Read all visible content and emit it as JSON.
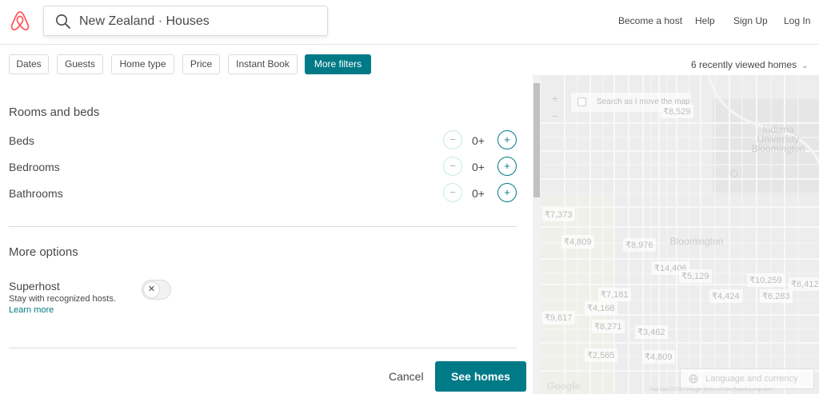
{
  "header": {
    "search_text": "New Zealand · Houses",
    "nav": {
      "become_host": "Become a host",
      "help": "Help",
      "sign_up": "Sign Up",
      "log_in": "Log In"
    }
  },
  "filters": {
    "chips": {
      "dates": "Dates",
      "guests": "Guests",
      "home_type": "Home type",
      "price": "Price",
      "instant_book": "Instant Book",
      "more_filters": "More filters"
    },
    "recently_viewed": "6 recently viewed homes"
  },
  "panel": {
    "rooms_title": "Rooms and beds",
    "rows": {
      "beds": {
        "label": "Beds",
        "value": "0+"
      },
      "bedrooms": {
        "label": "Bedrooms",
        "value": "0+"
      },
      "bathrooms": {
        "label": "Bathrooms",
        "value": "0+"
      }
    },
    "stepper": {
      "minus": "−",
      "plus": "+"
    },
    "more_options_title": "More options",
    "superhost": {
      "label": "Superhost",
      "description": "Stay with recognized hosts.",
      "learn_more": "Learn more",
      "toggle_symbol": "✕"
    },
    "cancel": "Cancel",
    "see_homes": "See homes"
  },
  "map": {
    "zoom_in": "+",
    "zoom_out": "−",
    "search_as_move": "Search as I move the map",
    "place_university": "Indiana University Bloomington",
    "place_city": "Bloomington",
    "prices": {
      "p1": "₹8,529",
      "p2": "₹7,373",
      "p3": "₹4,809",
      "p4": "₹8,976",
      "p5": "₹14,406",
      "p6": "₹5,129",
      "p7": "₹10,259",
      "p8": "₹6,412",
      "p9": "₹7,181",
      "p10": "₹4,424",
      "p11": "₹6,283",
      "p12": "₹4,168",
      "p13": "₹9,617",
      "p14": "₹8,271",
      "p15": "₹3,462",
      "p16": "₹2,565",
      "p17": "₹4,809"
    },
    "language_currency": "Language and currency",
    "google": "Google",
    "footer": "Map data ©2017 Google   Terms of Use   Report a map error"
  },
  "colors": {
    "accent": "#007a87",
    "brand": "#ff5a5f"
  }
}
